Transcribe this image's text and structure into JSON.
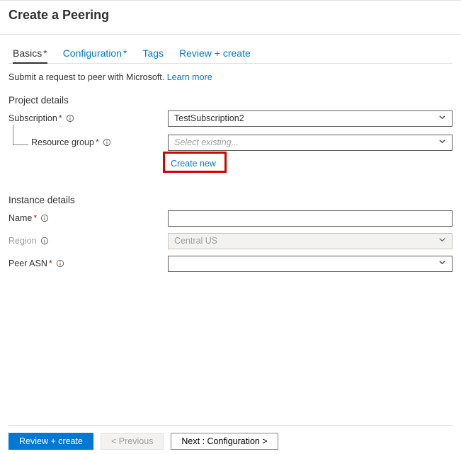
{
  "pageTitle": "Create a Peering",
  "tabs": {
    "basics": "Basics",
    "configuration": "Configuration",
    "tags": "Tags",
    "review": "Review + create"
  },
  "description": {
    "text": "Submit a request to peer with Microsoft.",
    "learnMore": "Learn more"
  },
  "sections": {
    "project": "Project details",
    "instance": "Instance details"
  },
  "fields": {
    "subscription": {
      "label": "Subscription",
      "value": "TestSubscription2"
    },
    "resourceGroup": {
      "label": "Resource group",
      "placeholder": "Select existing...",
      "createNew": "Create new"
    },
    "name": {
      "label": "Name",
      "value": ""
    },
    "region": {
      "label": "Region",
      "value": "Central US"
    },
    "peerAsn": {
      "label": "Peer ASN",
      "value": ""
    }
  },
  "footer": {
    "reviewCreate": "Review + create",
    "previous": "< Previous",
    "next": "Next : Configuration >"
  }
}
